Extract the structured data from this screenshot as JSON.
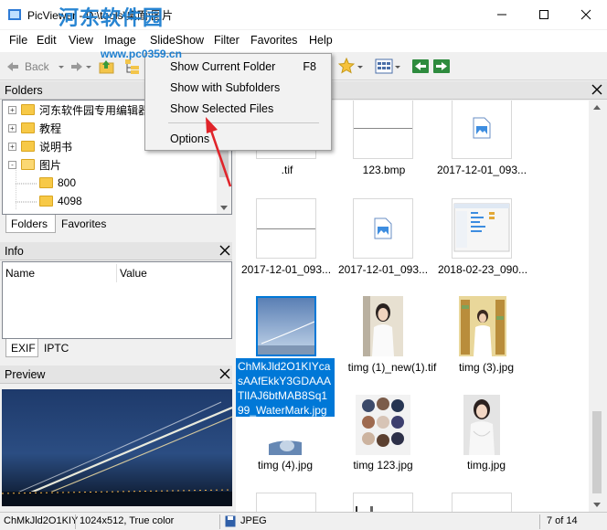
{
  "window": {
    "title": "PicViewer - D:\\tools\\桌面\\图片",
    "watermark": "河东软件园",
    "watermark_url": "www.pc0359.cn"
  },
  "menu": {
    "items": [
      "File",
      "Edit",
      "View",
      "Image",
      "SlideShow",
      "Filter",
      "Favorites",
      "Help"
    ]
  },
  "toolbar": {
    "back_label": "Back"
  },
  "context_menu": {
    "items": [
      {
        "label": "Show Current Folder",
        "shortcut": "F8"
      },
      {
        "label": "Show with Subfolders",
        "shortcut": ""
      },
      {
        "label": "Show Selected Files",
        "shortcut": ""
      },
      {
        "label": "Options",
        "shortcut": ""
      }
    ]
  },
  "folders_pane": {
    "title": "Folders",
    "tree": [
      {
        "label": "河东软件园专用编辑器",
        "level": 0,
        "expander": "+"
      },
      {
        "label": "教程",
        "level": 0,
        "expander": "+"
      },
      {
        "label": "说明书",
        "level": 0,
        "expander": "+"
      },
      {
        "label": "图片",
        "level": 0,
        "expander": "-"
      },
      {
        "label": "800",
        "level": 1,
        "expander": ""
      },
      {
        "label": "4098",
        "level": 1,
        "expander": ""
      }
    ],
    "tabs": [
      "Folders",
      "Favorites"
    ]
  },
  "info_pane": {
    "title": "Info",
    "columns": [
      "Name",
      "Value"
    ],
    "tabs": [
      "EXIF",
      "IPTC"
    ]
  },
  "preview_pane": {
    "title": "Preview"
  },
  "thumbnails": [
    {
      "caption": ".tif",
      "kind": "blank"
    },
    {
      "caption": "123.bmp",
      "kind": "line"
    },
    {
      "caption": "2017-12-01_093...",
      "kind": "doc-icon"
    },
    {
      "caption": "2017-12-01_093...",
      "kind": "line"
    },
    {
      "caption": "2017-12-01_093...",
      "kind": "doc-icon"
    },
    {
      "caption": "2018-02-23_090...",
      "kind": "screenshot"
    },
    {
      "caption": "ChMkJld2O1KIYcasAAfEkkY3GDAAATlIAJ6btMAB8Sq199_WaterMark.jpg",
      "kind": "night-photo",
      "selected": true
    },
    {
      "caption": "timg (1)_new(1).tif",
      "kind": "photo-girl"
    },
    {
      "caption": "timg (3).jpg",
      "kind": "photo-books"
    },
    {
      "caption": "timg (4).jpg",
      "kind": "photo-partial"
    },
    {
      "caption": "timg 123.jpg",
      "kind": "photo-circles"
    },
    {
      "caption": "timg.jpg",
      "kind": "photo-girl2"
    }
  ],
  "statusbar": {
    "filename": "ChMkJld2O1KIY",
    "dimensions": "1024x512, True color",
    "format": "JPEG",
    "position": "7 of 14"
  },
  "colors": {
    "selection": "#0078d7",
    "folder": "#f7c947"
  }
}
